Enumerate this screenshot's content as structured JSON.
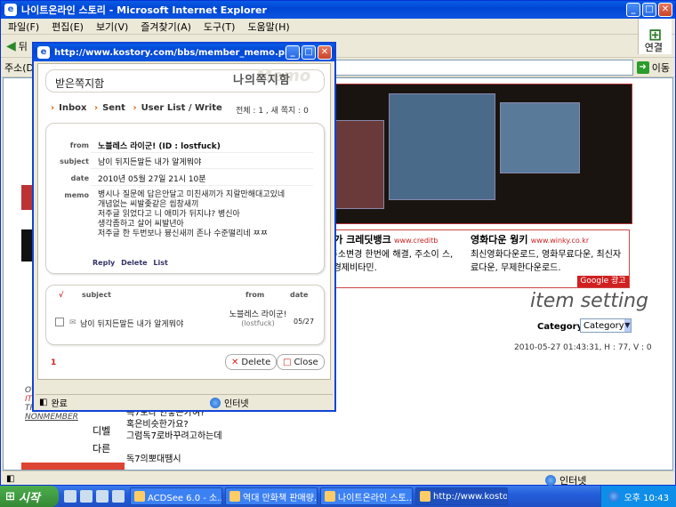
{
  "ie": {
    "title": "나이트온라인 스토리 - Microsoft Internet Explorer",
    "menu": [
      "파일(F)",
      "편집(E)",
      "보기(V)",
      "즐겨찾기(A)",
      "도구(T)",
      "도움말(H)"
    ],
    "back_label": "뒤",
    "link_label": "연결",
    "address_label": "주소(D)",
    "go_label": "이동",
    "status_left": "",
    "status_zone": "인터넷"
  },
  "page": {
    "ad_left_title": "용평가 크레딧뱅크",
    "ad_left_url": "www.creditb",
    "ad_left_text": "스, 주소변경 한번에 해결, 주소이 스, KBS경제비타민.",
    "ad_right_title": "영화다운 웡키",
    "ad_right_url": "www.winky.co.kr",
    "ad_right_text": "최신영화다운로드, 영화무료다운, 최신자료다운, 무제한다운로드.",
    "google_ad": "Google 광고",
    "item_setting": "item setting",
    "category_label": "Category :",
    "category_value": "Category",
    "date_line": "2010-05-27 01:43:31, H : 77, V : 0",
    "body_lines": [
      "독7보다 안좋은가여?",
      "혹은비슷한가요?",
      "그럼독7로바꾸려고하는데",
      "",
      "독7의뽀대땜시"
    ],
    "side_labels": [
      "디벨",
      "다른"
    ],
    "left_small": [
      "OT",
      "IT",
      "TR",
      "NONMEMBER"
    ]
  },
  "popup": {
    "title": "http://www.kostory.com/bbs/member_memo.ph...",
    "recv_label": "받은쪽지함",
    "header_right": "나의쪽지함",
    "watermark": "Memo",
    "nav": [
      "Inbox",
      "Sent",
      "User List / Write"
    ],
    "total": "전체 : 1 , 새 쪽지 : 0",
    "fields": {
      "from_label": "from",
      "from_value": "노블레스 라이군! (ID : lostfuck)",
      "subject_label": "subject",
      "subject_value": "남이 뒤지든말든 내가 알게뭐야",
      "date_label": "date",
      "date_value": "2010년 05월 27일 21시 10분",
      "memo_label": "memo",
      "memo_lines": [
        "병시나 질문에 답은안달고 미친새끼가 지랄만해대고있네",
        "개념없는 씨발좆같은 씹창새끼",
        "저주글 읽었다고 니 애미가 뒤지냐? 병신아",
        "생각좀하고 살어 씨발년아",
        "저주글 한 두번보나 븅신새끼 존나 수준떨리네 ㅉㅉ"
      ]
    },
    "actions": [
      "Reply",
      "Delete",
      "List"
    ],
    "list_headers": {
      "check": "√",
      "subject": "subject",
      "from": "from",
      "date": "date"
    },
    "list_rows": [
      {
        "subject": "남이 뒤지든말든 내가 알게뭐야",
        "from_name": "노블레스 라이군!",
        "from_id": "(lostfuck)",
        "date": "05/27"
      }
    ],
    "page_num": "1",
    "delete_btn": "Delete",
    "close_btn": "Close",
    "status_left": "완료",
    "status_zone": "인터넷"
  },
  "taskbar": {
    "start": "시작",
    "buttons": [
      "ACDSee 6.0 - 소...",
      "역대 만화책 판매량...",
      "나이트온라인 스토...",
      "http://www.kostor..."
    ],
    "clock": "오후 10:43"
  }
}
